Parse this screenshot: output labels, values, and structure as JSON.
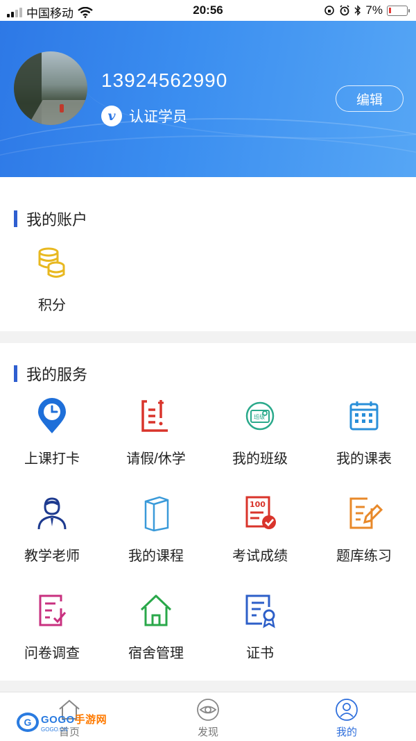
{
  "status_bar": {
    "carrier": "中国移动",
    "time": "20:56",
    "battery_percent": "7%"
  },
  "profile": {
    "phone": "13924562990",
    "badge_letter": "v",
    "badge_label": "认证学员",
    "edit_label": "编辑"
  },
  "account": {
    "title": "我的账户",
    "items": [
      {
        "label": "积分",
        "icon": "coins-icon",
        "color": "#e8b820"
      }
    ]
  },
  "services": {
    "title": "我的服务",
    "items": [
      {
        "label": "上课打卡",
        "icon": "clock-pin-icon",
        "color": "#1e6fd9"
      },
      {
        "label": "请假/休学",
        "icon": "leave-form-icon",
        "color": "#d9342b"
      },
      {
        "label": "我的班级",
        "icon": "class-badge-icon",
        "color": "#2aa98b"
      },
      {
        "label": "我的课表",
        "icon": "calendar-icon",
        "color": "#2a8fd9"
      },
      {
        "label": "教学老师",
        "icon": "teacher-icon",
        "color": "#1d3a8f"
      },
      {
        "label": "我的课程",
        "icon": "book-icon",
        "color": "#3a9ad9"
      },
      {
        "label": "考试成绩",
        "icon": "exam-score-icon",
        "color": "#d9342b"
      },
      {
        "label": "题库练习",
        "icon": "practice-edit-icon",
        "color": "#e8892a"
      },
      {
        "label": "问卷调查",
        "icon": "survey-check-icon",
        "color": "#c8307f"
      },
      {
        "label": "宿舍管理",
        "icon": "dorm-house-icon",
        "color": "#2aa84a"
      },
      {
        "label": "证书",
        "icon": "certificate-icon",
        "color": "#2d5fc8"
      }
    ]
  },
  "tabbar": {
    "tabs": [
      {
        "label": "首页",
        "icon": "home-icon",
        "active": false
      },
      {
        "label": "发现",
        "icon": "eye-icon",
        "active": false
      },
      {
        "label": "我的",
        "icon": "user-icon",
        "active": true
      }
    ]
  },
  "watermark": {
    "logo_letter": "G",
    "text_blue": "GOGO",
    "text_orange": "手游网",
    "sub": "GOGO.CN"
  }
}
